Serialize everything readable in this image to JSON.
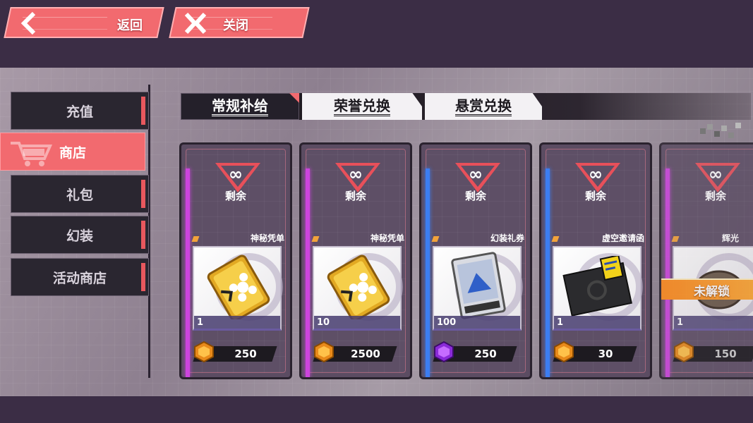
{
  "topbar": {
    "back_label": "返回",
    "close_label": "关闭"
  },
  "sidebar": {
    "items": [
      {
        "label": "充值",
        "active": false
      },
      {
        "label": "商店",
        "active": true,
        "icon": "cart-icon"
      },
      {
        "label": "礼包",
        "active": false
      },
      {
        "label": "幻装",
        "active": false
      },
      {
        "label": "活动商店",
        "active": false
      }
    ]
  },
  "tabs": [
    {
      "label": "常规补给",
      "active": true
    },
    {
      "label": "荣誉兑换",
      "active": false
    },
    {
      "label": "悬赏兑换",
      "active": false
    }
  ],
  "shop": {
    "stock_symbol": "∞",
    "stock_label": "剩余",
    "locked_label": "未解锁",
    "items": [
      {
        "name": "神秘凭单",
        "qty": "1",
        "price": "250",
        "rarity_color": "#cc44dd",
        "icon": "golden-voucher-icon",
        "coin": "orange-coin-icon"
      },
      {
        "name": "神秘凭单",
        "qty": "10",
        "price": "2500",
        "rarity_color": "#cc44dd",
        "icon": "golden-voucher-icon",
        "coin": "orange-coin-icon"
      },
      {
        "name": "幻装礼券",
        "qty": "100",
        "price": "250",
        "rarity_color": "#3c7df2",
        "icon": "skin-ticket-icon",
        "coin": "purple-coin-icon"
      },
      {
        "name": "虚空邀请函",
        "qty": "1",
        "price": "30",
        "rarity_color": "#3c7df2",
        "icon": "void-invitation-icon",
        "coin": "orange-coin-icon"
      },
      {
        "name": "辉光",
        "qty": "1",
        "price": "150",
        "rarity_color": "#cc44dd",
        "icon": "glow-item-icon",
        "coin": "orange-coin-icon",
        "locked": true
      }
    ]
  }
}
